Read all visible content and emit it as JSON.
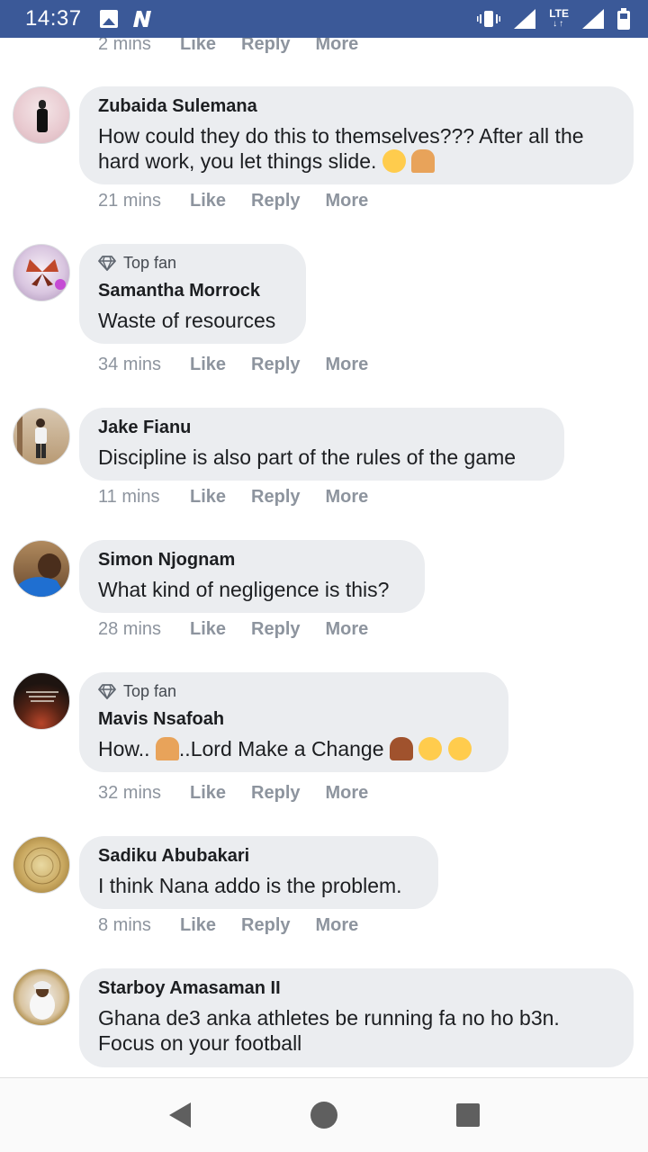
{
  "status_bar": {
    "time": "14:37",
    "network": "LTE",
    "network_arrows": "↓↑",
    "icons": [
      "image-icon",
      "n-app-icon",
      "vibrate-icon",
      "signal-icon",
      "signal-icon",
      "battery-icon"
    ]
  },
  "partial_top": {
    "time": "2 mins",
    "like": "Like",
    "reply": "Reply",
    "more": "More"
  },
  "comments": [
    {
      "name": "Zubaida Sulemana",
      "text": "How could they do this to themselves??? After all the hard work, you let things slide.",
      "time": "21 mins",
      "like": "Like",
      "reply": "Reply",
      "more": "More"
    },
    {
      "badge": "Top fan",
      "name": "Samantha Morrock",
      "text": "Waste of resources",
      "time": "34 mins",
      "like": "Like",
      "reply": "Reply",
      "more": "More"
    },
    {
      "name": "Jake Fianu",
      "text": "Discipline is also part of the rules of the game",
      "time": "11 mins",
      "like": "Like",
      "reply": "Reply",
      "more": "More"
    },
    {
      "name": "Simon Njognam",
      "text": "What kind of negligence is this?",
      "time": "28 mins",
      "like": "Like",
      "reply": "Reply",
      "more": "More"
    },
    {
      "badge": "Top fan",
      "name": "Mavis Nsafoah",
      "text_a": "How..",
      "text_b": "..Lord Make a Change",
      "time": "32 mins",
      "like": "Like",
      "reply": "Reply",
      "more": "More"
    },
    {
      "name": "Sadiku Abubakari",
      "text": "I think Nana addo is the problem.",
      "time": "8 mins",
      "like": "Like",
      "reply": "Reply",
      "more": "More"
    },
    {
      "name": "Starboy Amasaman II",
      "text_line1": "Ghana de3 anka athletes be running fa no ho b3n.",
      "text_line2": "Focus on your football"
    }
  ],
  "colors": {
    "status_bar": "#3b5998",
    "bubble": "#ebedf0",
    "meta_text": "#8d949e"
  }
}
